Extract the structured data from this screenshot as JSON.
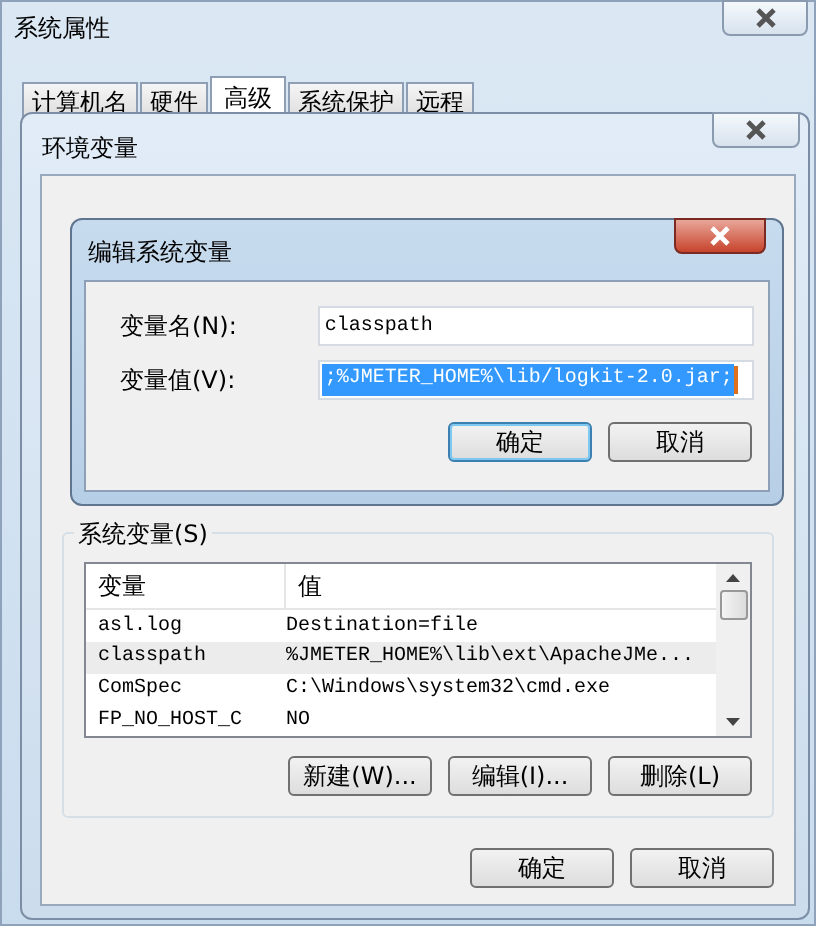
{
  "system_properties": {
    "title": "系统属性",
    "tabs": [
      {
        "label": "计算机名",
        "selected": false
      },
      {
        "label": "硬件",
        "selected": false
      },
      {
        "label": "高级",
        "selected": true
      },
      {
        "label": "系统保护",
        "selected": false
      },
      {
        "label": "远程",
        "selected": false
      }
    ]
  },
  "environment_variables": {
    "title": "环境变量",
    "system_variables": {
      "legend": "系统变量(S)",
      "columns": [
        "变量",
        "值"
      ],
      "rows": [
        {
          "name": "asl.log",
          "value": "Destination=file",
          "selected": false
        },
        {
          "name": "classpath",
          "value": "%JMETER_HOME%\\lib\\ext\\ApacheJMe...",
          "selected": true
        },
        {
          "name": "ComSpec",
          "value": "C:\\Windows\\system32\\cmd.exe",
          "selected": false
        },
        {
          "name": "FP_NO_HOST_C",
          "value": "NO",
          "selected": false
        }
      ],
      "buttons": [
        "新建(W)...",
        "编辑(I)...",
        "删除(L)"
      ]
    },
    "buttons": [
      "确定",
      "取消"
    ]
  },
  "edit_dialog": {
    "title": "编辑系统变量",
    "fields": [
      {
        "label": "变量名(N):",
        "value": "classpath",
        "selected": false
      },
      {
        "label": "变量值(V):",
        "value": ";%JMETER_HOME%\\lib/logkit-2.0.jar;",
        "selected": true
      }
    ],
    "buttons": [
      {
        "label": "确定",
        "default": true
      },
      {
        "label": "取消",
        "default": false
      }
    ]
  }
}
